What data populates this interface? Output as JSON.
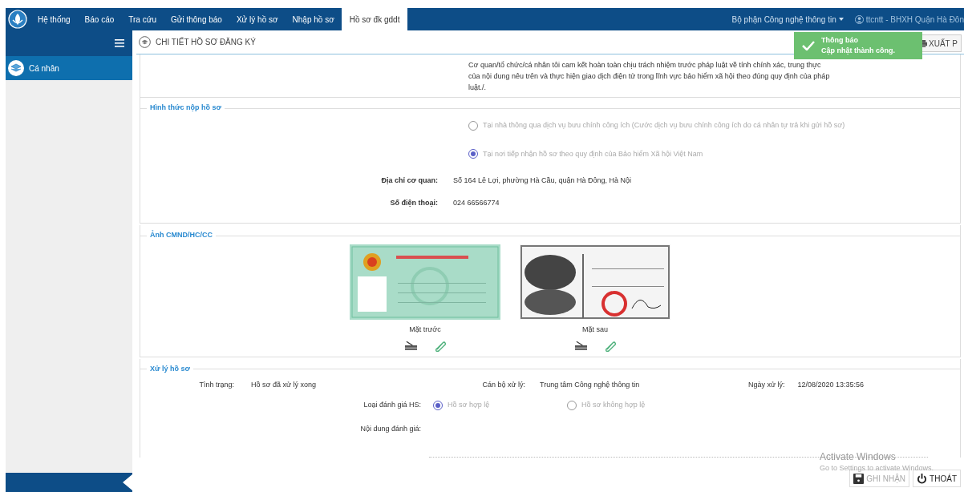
{
  "nav": {
    "items": [
      {
        "label": "Hệ thống",
        "selected": false
      },
      {
        "label": "Báo cáo",
        "selected": false
      },
      {
        "label": "Tra cứu",
        "selected": false
      },
      {
        "label": "Gửi thông báo",
        "selected": false
      },
      {
        "label": "Xử lý hồ sơ",
        "selected": false
      },
      {
        "label": "Nhập hồ sơ",
        "selected": false
      },
      {
        "label": "Hồ sơ đk gddt",
        "selected": true
      }
    ],
    "department": "Bộ phận Công nghệ thông tin",
    "user": "ttcntt - BHXH Quận Hà Đôn"
  },
  "toast": {
    "title": "Thông báo",
    "message": "Cập nhật thành công."
  },
  "sidebar": {
    "items": [
      {
        "label": "Cá nhân",
        "selected": true
      }
    ]
  },
  "page_title": "CHI TIẾT HỒ SƠ ĐĂNG KÝ",
  "export_button": "XUẤT P",
  "commitment": "Cơ quan/tổ chức/cá nhân tôi cam kết hoàn toàn chịu trách nhiệm trước pháp luật về tính chính xác, trung thực của nội dung nêu trên và thực hiện giao dịch điện tử trong lĩnh vực bảo hiểm xã hội theo đúng quy định của pháp luật./.",
  "submission": {
    "legend": "Hình thức nộp hồ sơ",
    "options": [
      {
        "label": "Tại nhà thông qua dịch vụ bưu chính công ích (Cước dịch vụ bưu chính công ích do cá nhân tự trả khi gửi hồ sơ)",
        "selected": false
      },
      {
        "label": "Tại nơi tiếp nhận hồ sơ theo quy định của Bảo hiểm Xã hội Việt Nam",
        "selected": true
      }
    ],
    "fields": [
      {
        "label": "Địa chỉ cơ quan:",
        "value": "Số 164 Lê Lợi, phường Hà Cầu, quận Hà Đông, Hà Nội"
      },
      {
        "label": "Số điện thoại:",
        "value": "024 66566774"
      }
    ]
  },
  "id_photos": {
    "legend": "Ảnh CMND/HC/CC",
    "items": [
      {
        "caption": "Mặt trước",
        "kind": "front"
      },
      {
        "caption": "Mặt sau",
        "kind": "back"
      }
    ]
  },
  "processing": {
    "legend": "Xử lý hồ sơ",
    "status_label": "Tình trạng:",
    "status_value": "Hồ sơ đã xử lý xong",
    "officer_label": "Cán bộ xử lý:",
    "officer_value": "Trung tâm Công nghệ thông tin",
    "date_label": "Ngày xử lý:",
    "date_value": "12/08/2020 13:35:56",
    "evaluation_label": "Loại đánh giá HS:",
    "options": [
      {
        "label": "Hồ sơ hợp lệ",
        "selected": true
      },
      {
        "label": "Hồ sơ không hợp lệ",
        "selected": false
      }
    ],
    "content_label": "Nội dung đánh giá:"
  },
  "buttons": [
    {
      "label": "GHI NHẬN",
      "kind": "save",
      "disabled": true
    },
    {
      "label": "THOÁT",
      "kind": "exit",
      "disabled": false
    }
  ],
  "os_notice": {
    "title": "Activate Windows",
    "subtitle": "Go to Settings to activate Windows."
  }
}
